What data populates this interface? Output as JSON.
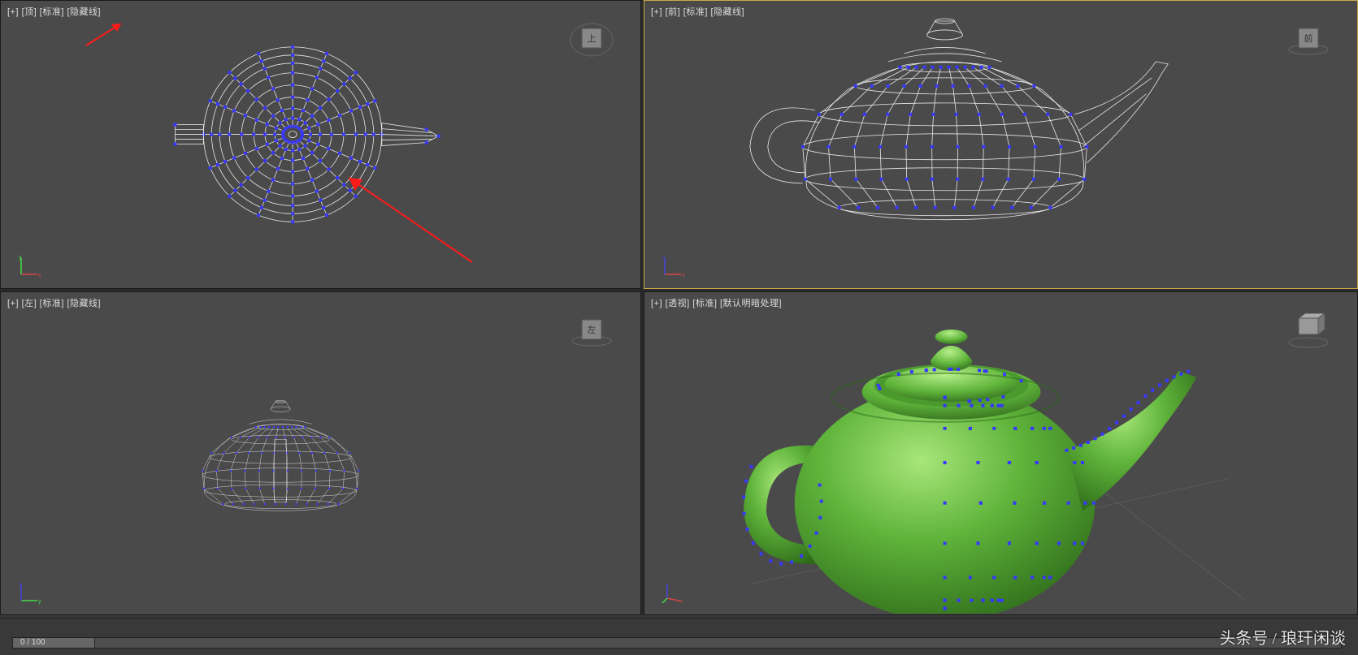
{
  "viewports": {
    "top_left": {
      "plus": "[+]",
      "view": "[顶]",
      "mode": "[标准]",
      "shading": "[隐藏线]"
    },
    "top_right": {
      "plus": "[+]",
      "view": "[前]",
      "mode": "[标准]",
      "shading": "[隐藏线]"
    },
    "bottom_left": {
      "plus": "[+]",
      "view": "[左]",
      "mode": "[标准]",
      "shading": "[隐藏线]"
    },
    "bottom_right": {
      "plus": "[+]",
      "view": "[透视]",
      "mode": "[标准]",
      "shading": "[默认明暗处理]"
    }
  },
  "view_cube_labels": {
    "top": "上",
    "front": "前",
    "left": "左"
  },
  "timeline": {
    "frame_label": "0 / 100"
  },
  "watermark": "头条号 / 琅玕闲谈",
  "colors": {
    "vertex": "#3838ff",
    "edge": "#e8e8e8",
    "shaded_teapot": "#5fb43a",
    "arrow": "#ff1a1a",
    "active_border": "#c9a94a"
  },
  "axes": {
    "x": "x",
    "y": "y",
    "z": "z"
  }
}
